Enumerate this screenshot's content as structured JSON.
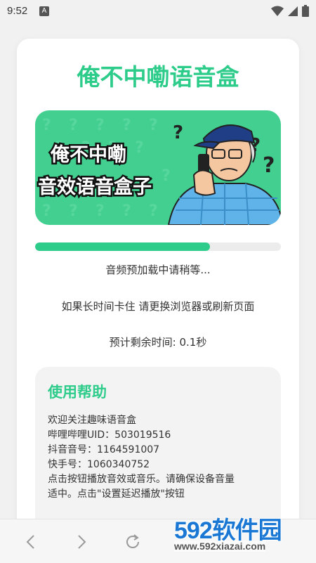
{
  "status_bar": {
    "time": "9:52",
    "notif_glyph": "A"
  },
  "card": {
    "title": "俺不中嘞语音盒",
    "banner": {
      "line1": "俺不中嘞",
      "line2": "音效语音盒子"
    },
    "progress": {
      "fraction": 0.71
    },
    "loading_text": "音频预加载中请稍等...",
    "stuck_hint": "如果长时间卡住 请更换浏览器或刷新页面",
    "remaining": "预计剩余时间: 0.1秒",
    "help": {
      "title": "使用帮助",
      "lines": [
        "欢迎关注趣味语音盒",
        "哔哩哔哩UID：503019516",
        "抖音音号：1164591007",
        "快手号：1060340752",
        "点击按钮播放音效或音乐。请确保设备音量",
        "适中。点击\"设置延迟播放\"按钮"
      ]
    }
  },
  "watermark": {
    "brand": "592软件园",
    "url": "www.592xiazai.com"
  },
  "colors": {
    "accent": "#2ecc8b",
    "banner": "#43cf8f"
  },
  "icons": [
    "wifi-icon",
    "signal-icon",
    "battery-icon",
    "back-icon",
    "forward-icon",
    "reload-icon"
  ]
}
